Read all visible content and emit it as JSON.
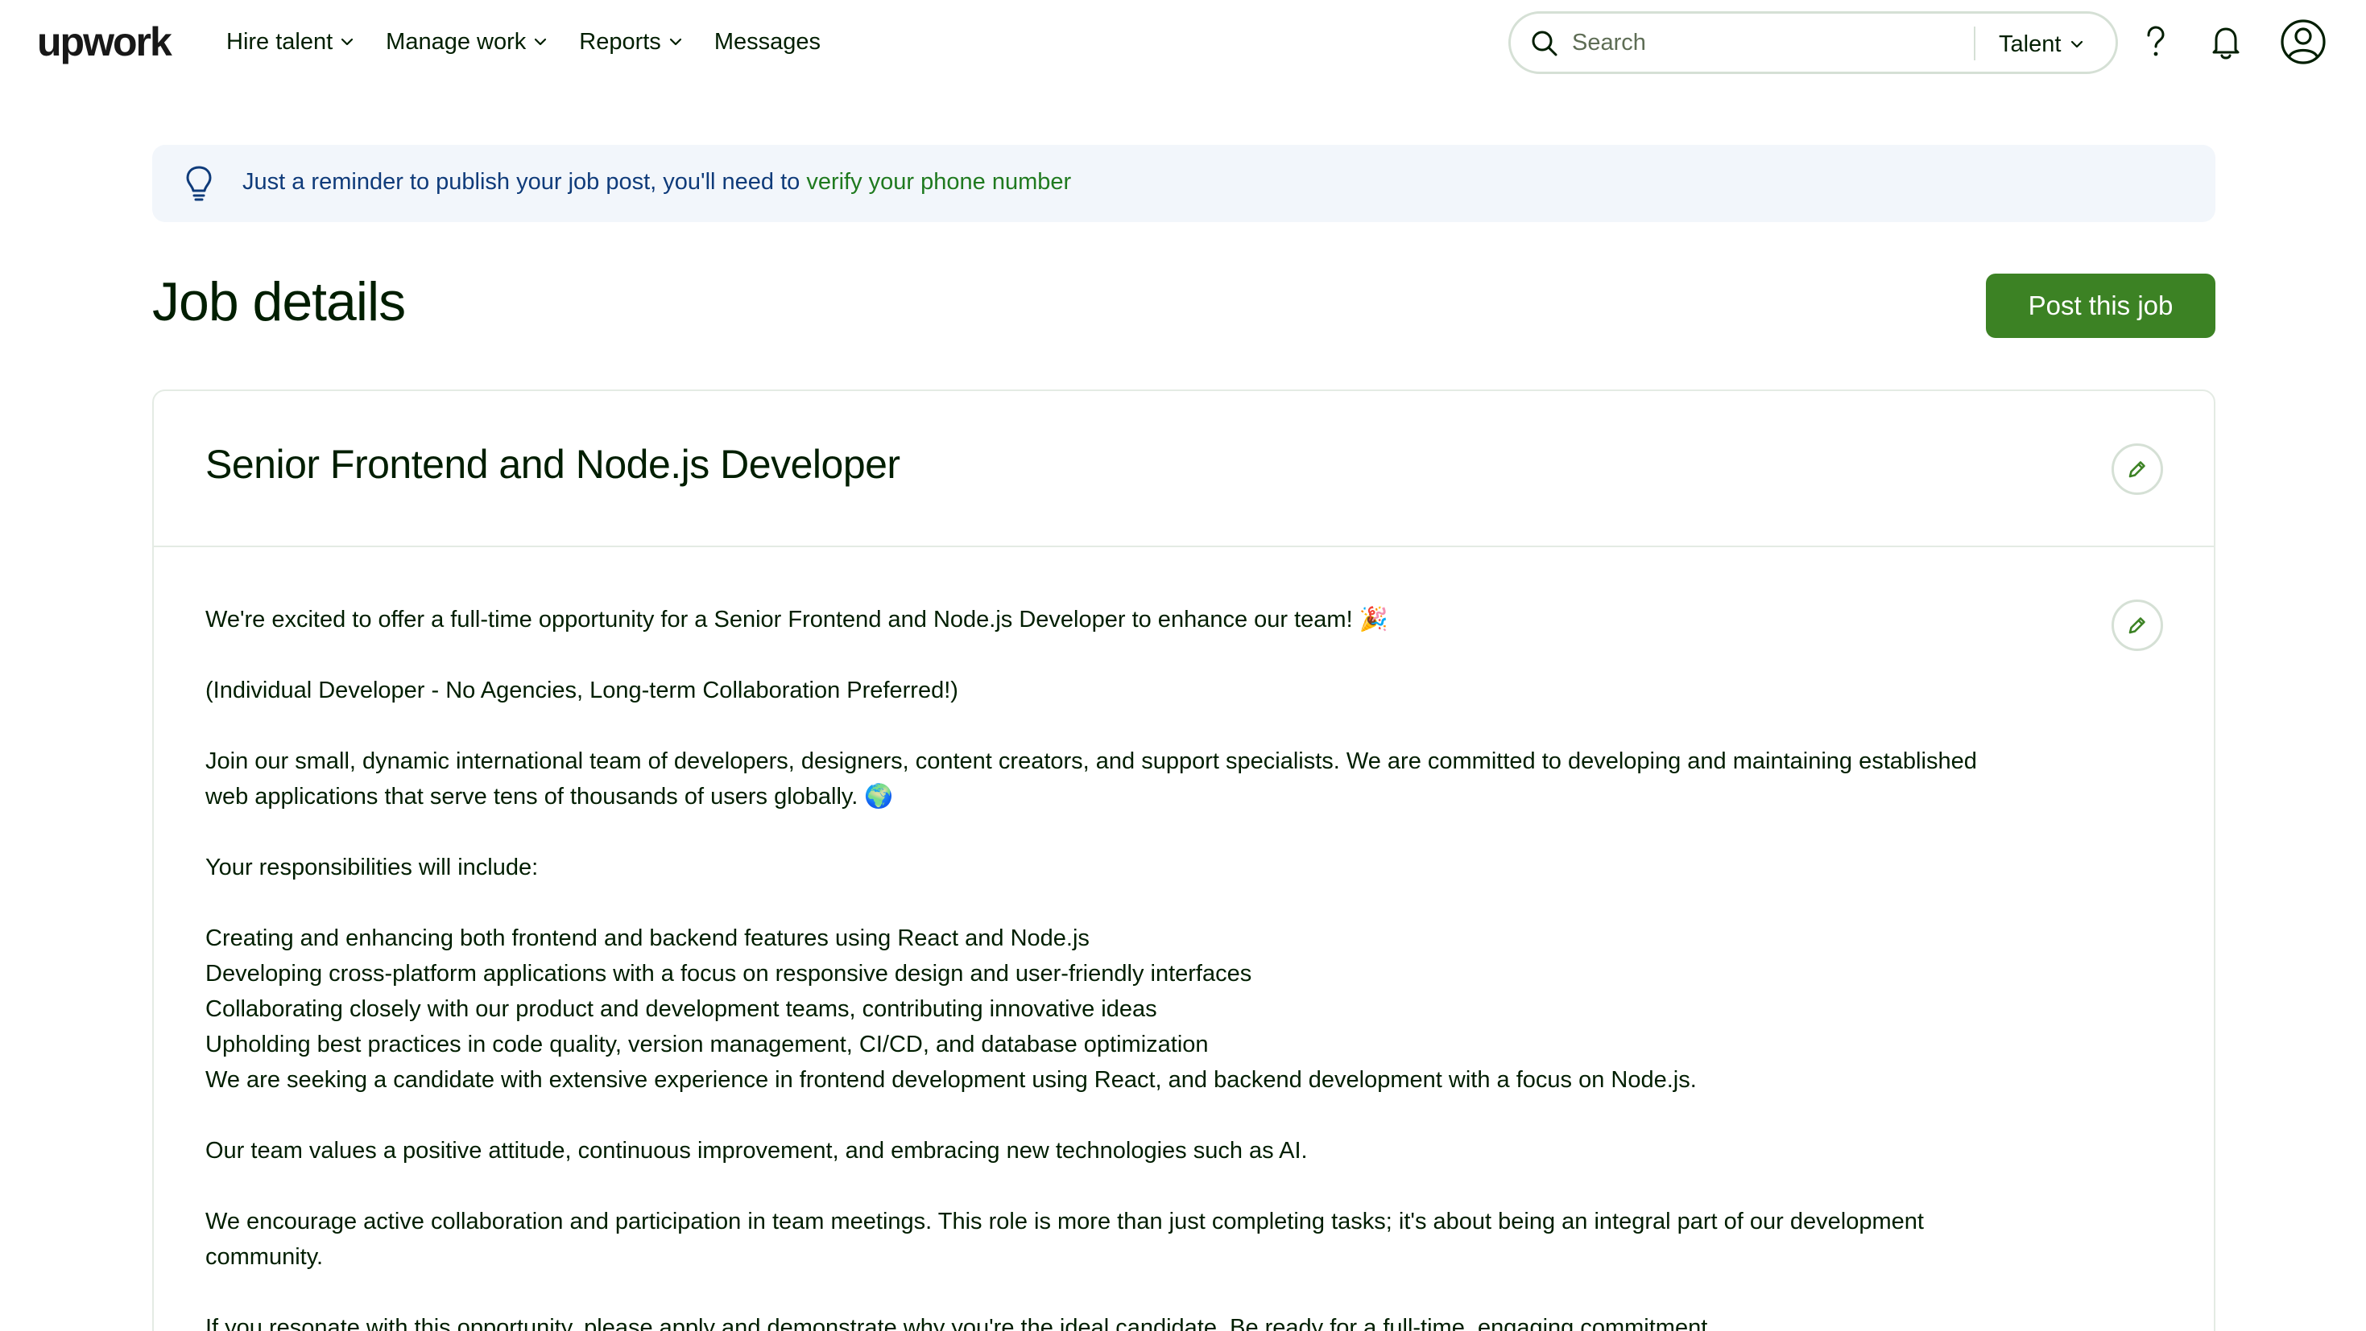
{
  "header": {
    "logo": "upwork",
    "nav": [
      "Hire talent",
      "Manage work",
      "Reports",
      "Messages"
    ],
    "search": {
      "placeholder": "Search",
      "scope": "Talent"
    }
  },
  "banner": {
    "text": "Just a reminder to publish your job post, you'll need to ",
    "link": "verify your phone number"
  },
  "page": {
    "title": "Job details",
    "post_button": "Post this job"
  },
  "job": {
    "title": "Senior Frontend and Node.js Developer",
    "description": [
      "We're excited to offer a full-time opportunity for a Senior Frontend and Node.js Developer to enhance our team! 🎉",
      "",
      "(Individual Developer - No Agencies, Long-term Collaboration Preferred!)",
      "",
      "Join our small, dynamic international team of developers, designers, content creators, and support specialists. We are committed to developing and maintaining established web applications that serve tens of thousands of users globally. 🌍",
      "",
      "Your responsibilities will include:",
      "",
      "Creating and enhancing both frontend and backend features using React and Node.js",
      "Developing cross-platform applications with a focus on responsive design and user-friendly interfaces",
      "Collaborating closely with our product and development teams, contributing innovative ideas",
      "Upholding best practices in code quality, version management, CI/CD, and database optimization",
      "We are seeking a candidate with extensive experience in frontend development using React, and backend development with a focus on Node.js.",
      "",
      "Our team values a positive attitude, continuous improvement, and embracing new technologies such as AI.",
      "",
      "We encourage active collaboration and participation in team meetings. This role is more than just completing tasks; it's about being an integral part of our development community.",
      "",
      "If you resonate with this opportunity, please apply and demonstrate why you're the ideal candidate. Be ready for a full-time, engaging commitment."
    ]
  },
  "colors": {
    "brand_green": "#3c8224",
    "link_green": "#1f7a1f",
    "banner_bg": "#f2f6fb",
    "banner_text": "#0f3b7a",
    "border": "#e4ebe4"
  },
  "icons": [
    "search-icon",
    "chevron-down-icon",
    "question-mark-icon",
    "bell-icon",
    "user-circle-icon",
    "lightbulb-icon",
    "pencil-icon"
  ]
}
